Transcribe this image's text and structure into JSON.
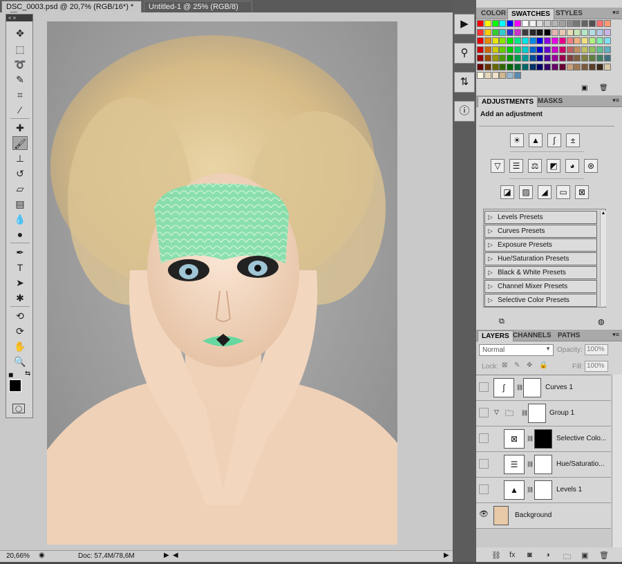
{
  "tabs": [
    {
      "label": "DSC_0003.psd @ 20,7% (RGB/16*) *",
      "active": true
    },
    {
      "label": "Untitled-1 @ 25% (RGB/8)",
      "active": false
    }
  ],
  "status": {
    "zoom": "20,66%",
    "doc": "Doc: 57,4M/78,6M"
  },
  "swatch_tabs": [
    "COLOR",
    "SWATCHES",
    "STYLES"
  ],
  "adjustments": {
    "tabs": [
      "ADJUSTMENTS",
      "MASKS"
    ],
    "heading": "Add an adjustment",
    "icons_row1": [
      "brightness-icon",
      "levels-icon",
      "curves-icon",
      "exposure-icon"
    ],
    "icons_row2": [
      "vibrance-icon",
      "hue-saturation-icon",
      "color-balance-icon",
      "black-white-icon",
      "photo-filter-icon",
      "channel-mixer-icon"
    ],
    "icons_row3": [
      "invert-icon",
      "posterize-icon",
      "threshold-icon",
      "gradient-map-icon",
      "selective-color-icon"
    ],
    "presets": [
      "Levels Presets",
      "Curves Presets",
      "Exposure Presets",
      "Hue/Saturation Presets",
      "Black & White Presets",
      "Channel Mixer Presets",
      "Selective Color Presets"
    ]
  },
  "layers": {
    "tabs": [
      "LAYERS",
      "CHANNELS",
      "PATHS"
    ],
    "blend_mode": "Normal",
    "opacity_label": "Opacity:",
    "opacity": "100%",
    "lock_label": "Lock:",
    "fill_label": "Fill:",
    "fill": "100%",
    "items": [
      {
        "name": "Curves 1"
      },
      {
        "name": "Group 1"
      },
      {
        "name": "Selective Colo..."
      },
      {
        "name": "Hue/Saturatio..."
      },
      {
        "name": "Levels 1"
      },
      {
        "name": "Background"
      }
    ]
  },
  "colors": {
    "accent": "#4a4a4a",
    "panel": "#d4d4d4",
    "makeup": "#5fd49a"
  }
}
